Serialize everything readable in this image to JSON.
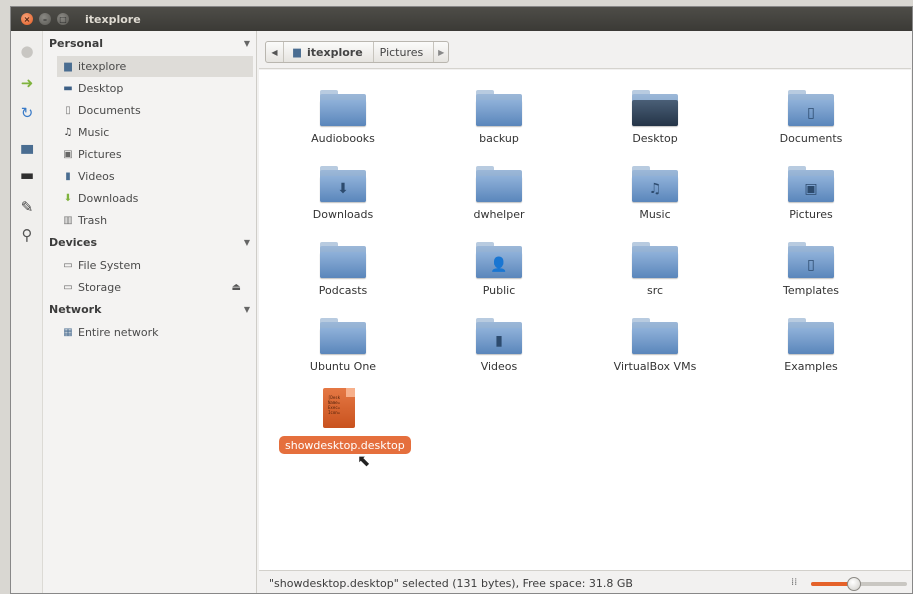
{
  "window": {
    "title": "itexplore"
  },
  "launcher": [
    {
      "name": "home-icon",
      "glyph": "●",
      "color": "#c8c6c2"
    },
    {
      "name": "forward-arrow-icon",
      "glyph": "➜",
      "color": "#7fb33d"
    },
    {
      "name": "reload-icon",
      "glyph": "↻",
      "color": "#3a7bc8"
    },
    {
      "name": "computer-icon",
      "glyph": "▄",
      "color": "#4a6d91"
    },
    {
      "name": "monitor-icon",
      "glyph": "▬",
      "color": "#2f2f2f"
    },
    {
      "name": "pen-icon",
      "glyph": "✎",
      "color": "#444444"
    },
    {
      "name": "search-icon",
      "glyph": "⚲",
      "color": "#555555"
    }
  ],
  "sidebar": {
    "personal": {
      "heading": "Personal",
      "items": [
        {
          "label": "itexplore",
          "icon": "home-folder-icon"
        },
        {
          "label": "Desktop",
          "icon": "desktop-icon"
        },
        {
          "label": "Documents",
          "icon": "documents-icon"
        },
        {
          "label": "Music",
          "icon": "music-icon"
        },
        {
          "label": "Pictures",
          "icon": "pictures-icon"
        },
        {
          "label": "Videos",
          "icon": "videos-icon"
        },
        {
          "label": "Downloads",
          "icon": "downloads-icon"
        },
        {
          "label": "Trash",
          "icon": "trash-icon"
        }
      ]
    },
    "devices": {
      "heading": "Devices",
      "items": [
        {
          "label": "File System",
          "icon": "drive-icon"
        },
        {
          "label": "Storage",
          "icon": "drive-icon"
        }
      ]
    },
    "network": {
      "heading": "Network",
      "items": [
        {
          "label": "Entire network",
          "icon": "network-icon"
        }
      ]
    }
  },
  "pathbar": {
    "crumbs": [
      "itexplore",
      "Pictures"
    ]
  },
  "files": [
    {
      "label": "Audiobooks",
      "emblem": ""
    },
    {
      "label": "backup",
      "emblem": ""
    },
    {
      "label": "Desktop",
      "emblem": "",
      "dark": true
    },
    {
      "label": "Documents",
      "emblem": "▯"
    },
    {
      "label": "Downloads",
      "emblem": "⬇"
    },
    {
      "label": "dwhelper",
      "emblem": ""
    },
    {
      "label": "Music",
      "emblem": "♫"
    },
    {
      "label": "Pictures",
      "emblem": "▣"
    },
    {
      "label": "Podcasts",
      "emblem": ""
    },
    {
      "label": "Public",
      "emblem": "👤"
    },
    {
      "label": "src",
      "emblem": ""
    },
    {
      "label": "Templates",
      "emblem": "▯"
    },
    {
      "label": "Ubuntu One",
      "emblem": ""
    },
    {
      "label": "Videos",
      "emblem": "▮"
    },
    {
      "label": "VirtualBox VMs",
      "emblem": ""
    },
    {
      "label": "Examples",
      "emblem": ""
    }
  ],
  "selected_file": {
    "label": "showdesktop.desktop",
    "lines": [
      "[Desk",
      "Name=",
      "Exec=",
      "Icon="
    ]
  },
  "status": {
    "text": "\"showdesktop.desktop\" selected (131 bytes), Free space: 31.8 GB",
    "zoom_fraction": 0.45
  },
  "colors": {
    "accent": "#e56f3d",
    "folder": "#6f93bf"
  }
}
